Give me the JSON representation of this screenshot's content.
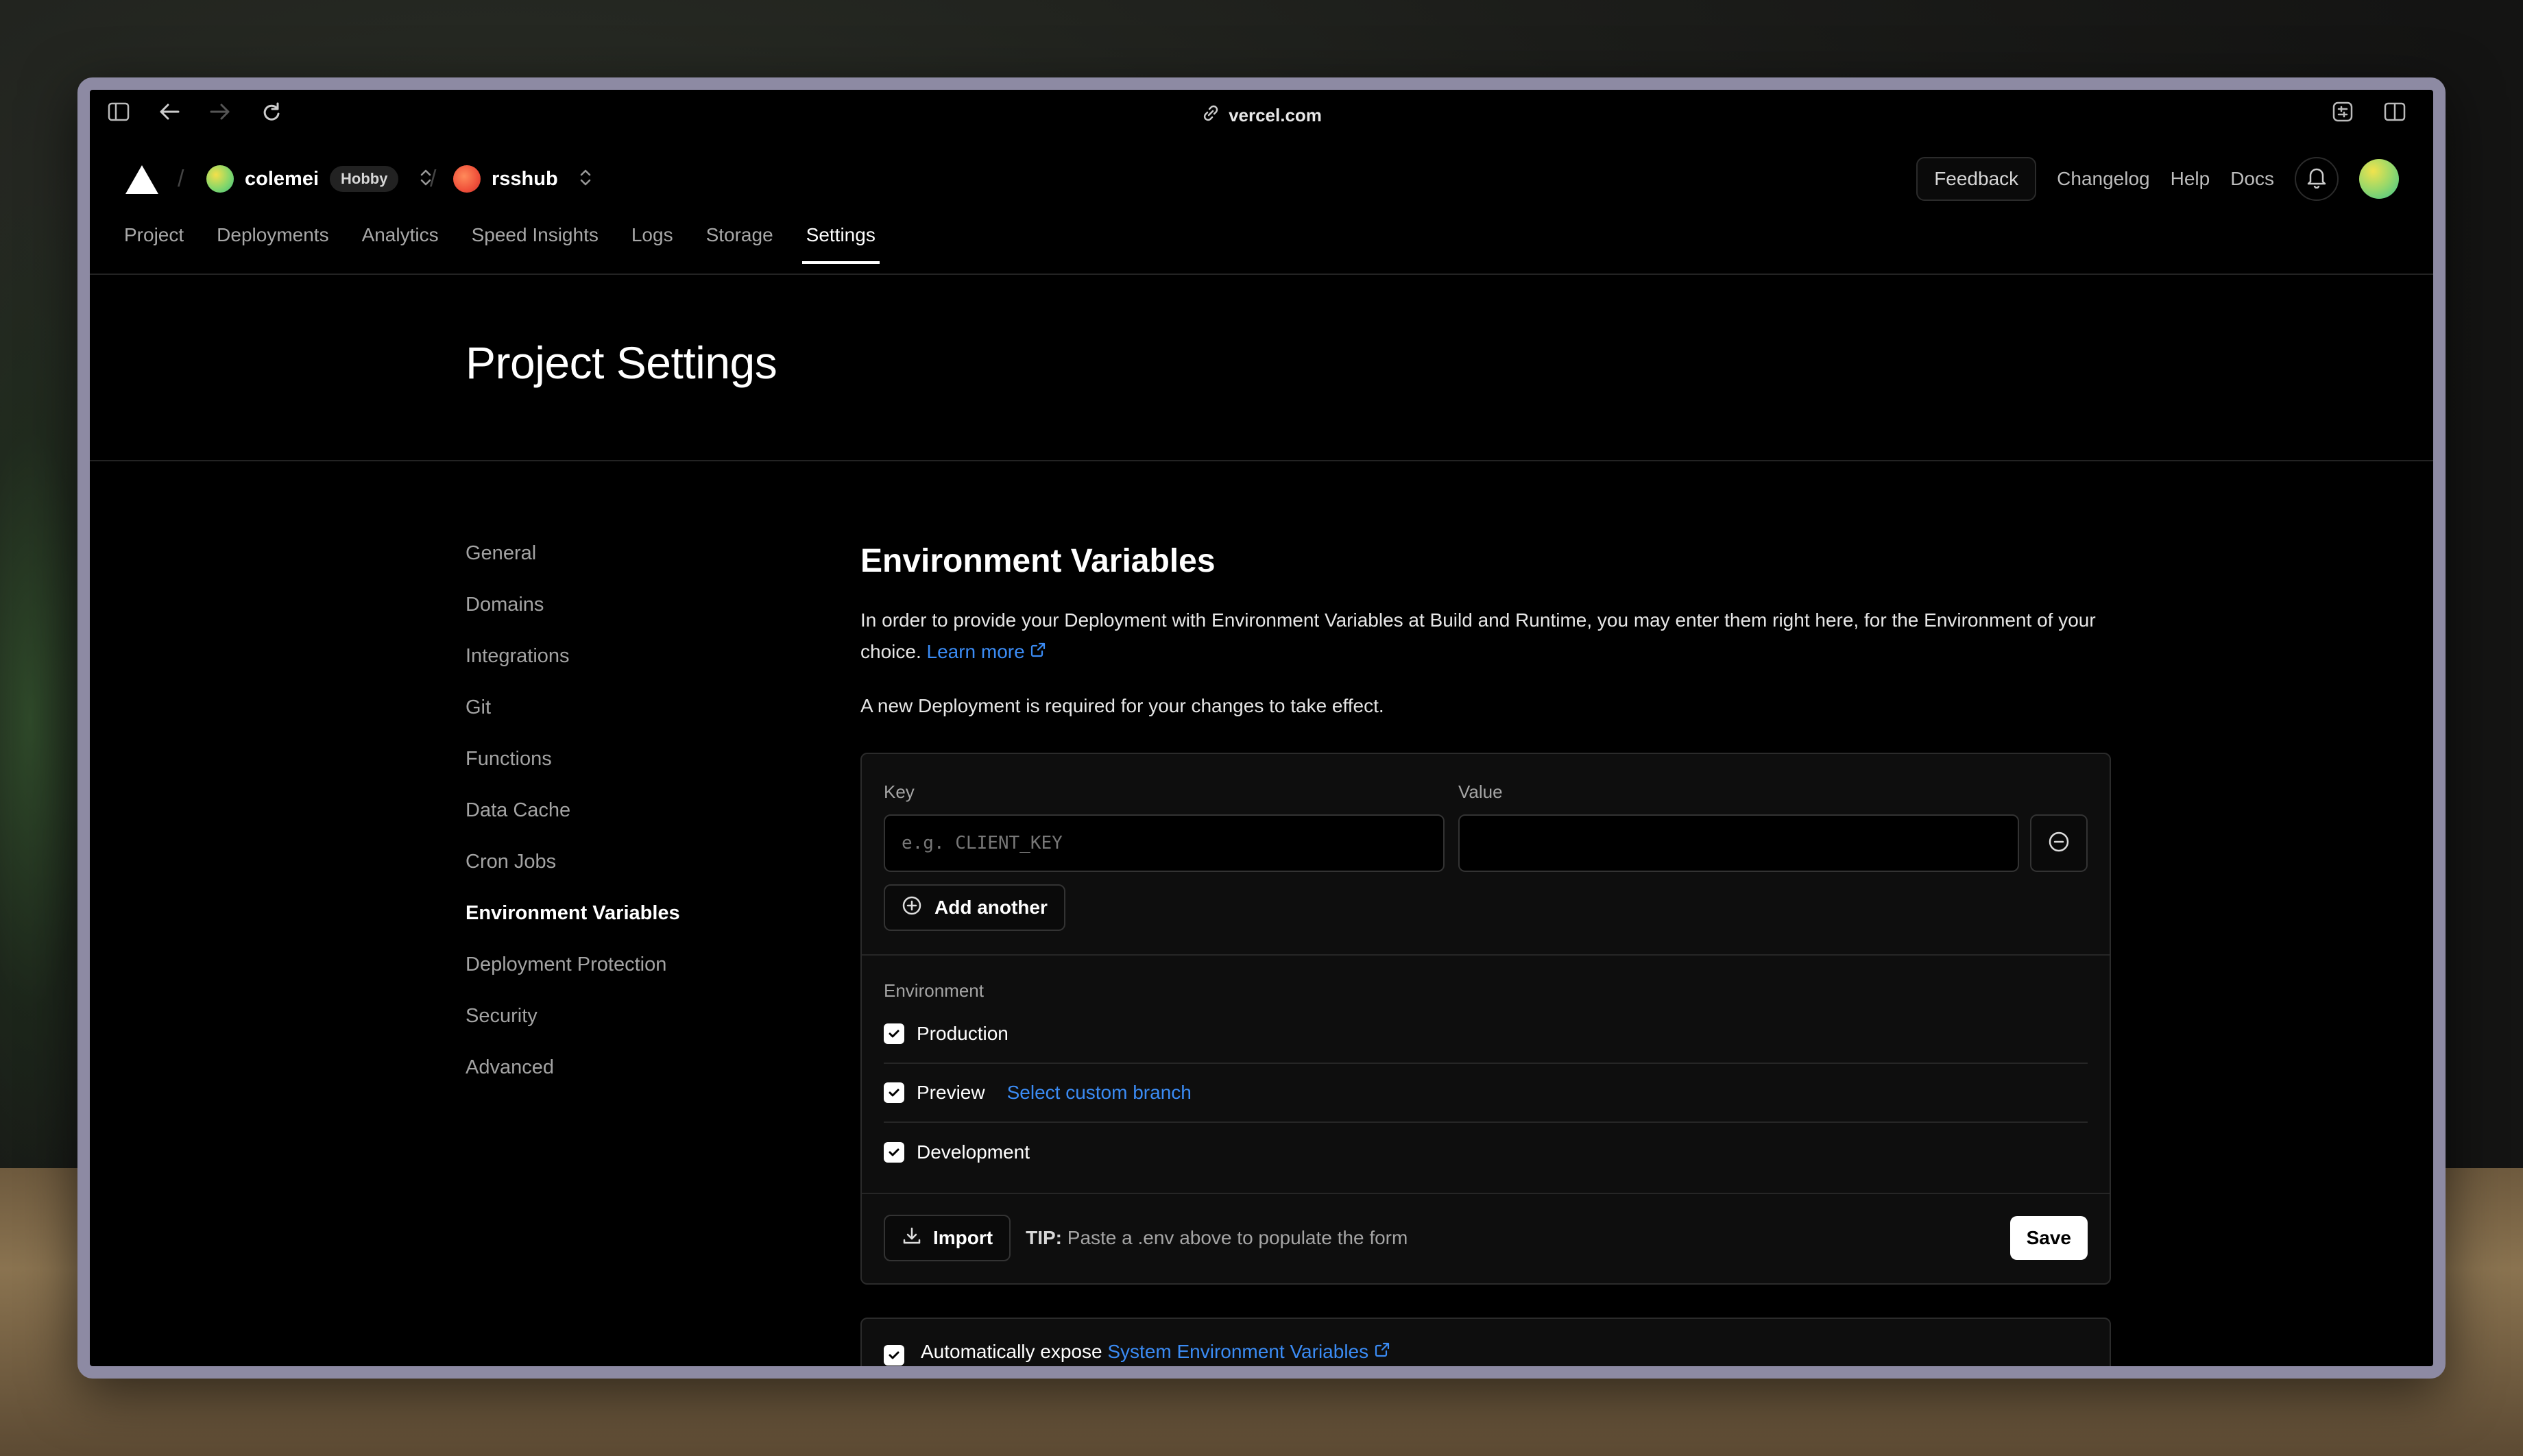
{
  "browser": {
    "url": "vercel.com"
  },
  "header": {
    "team_name": "colemei",
    "team_plan": "Hobby",
    "project_name": "rsshub",
    "feedback_label": "Feedback",
    "links": [
      "Changelog",
      "Help",
      "Docs"
    ]
  },
  "tabs": [
    {
      "label": "Project",
      "active": false
    },
    {
      "label": "Deployments",
      "active": false
    },
    {
      "label": "Analytics",
      "active": false
    },
    {
      "label": "Speed Insights",
      "active": false
    },
    {
      "label": "Logs",
      "active": false
    },
    {
      "label": "Storage",
      "active": false
    },
    {
      "label": "Settings",
      "active": true
    }
  ],
  "page_title": "Project Settings",
  "sidebar": {
    "items": [
      {
        "label": "General"
      },
      {
        "label": "Domains"
      },
      {
        "label": "Integrations"
      },
      {
        "label": "Git"
      },
      {
        "label": "Functions"
      },
      {
        "label": "Data Cache"
      },
      {
        "label": "Cron Jobs"
      },
      {
        "label": "Environment Variables",
        "active": true
      },
      {
        "label": "Deployment Protection"
      },
      {
        "label": "Security"
      },
      {
        "label": "Advanced"
      }
    ]
  },
  "env": {
    "title": "Environment Variables",
    "description": "In order to provide your Deployment with Environment Variables at Build and Runtime, you may enter them right here, for the Environment of your choice.",
    "learn_more": "Learn more",
    "note": "A new Deployment is required for your changes to take effect.",
    "key_label": "Key",
    "key_placeholder": "e.g. CLIENT_KEY",
    "key_value": "",
    "value_label": "Value",
    "value_value": "",
    "add_another": "Add another",
    "environment_label": "Environment",
    "environments": [
      {
        "label": "Production",
        "checked": true
      },
      {
        "label": "Preview",
        "checked": true,
        "extra": "Select custom branch"
      },
      {
        "label": "Development",
        "checked": true
      }
    ],
    "import_label": "Import",
    "tip_prefix": "TIP:",
    "tip_text": "Paste a .env above to populate the form",
    "save_label": "Save",
    "auto_expose_text": "Automatically expose",
    "auto_expose_link": "System Environment Variables",
    "auto_expose_checked": true
  },
  "colors": {
    "link": "#3b8cf5",
    "background": "#000000",
    "frame": "#8d8aa3"
  }
}
